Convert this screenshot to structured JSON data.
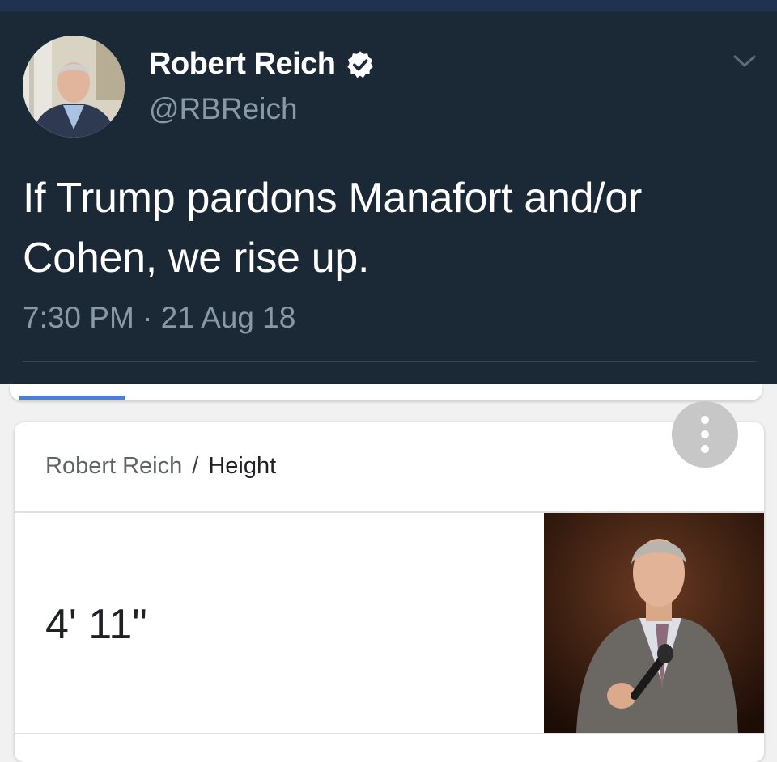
{
  "tweet": {
    "author_name": "Robert Reich",
    "handle": "@RBReich",
    "text": "If Trump pardons Manafort and/or Cohen, we rise up.",
    "timestamp": "7:30 PM · 21 Aug 18",
    "icons": {
      "verified": "verified-badge-icon",
      "menu": "chevron-down-icon"
    }
  },
  "knowledge_card": {
    "breadcrumb": {
      "entity": "Robert Reich",
      "separator": "/",
      "attribute": "Height"
    },
    "answer": "4' 11\"",
    "more_button_icon": "more-vert-icon"
  },
  "colors": {
    "tweet_background": "#1b2836",
    "card_background": "#ffffff",
    "accent": "#4a7fd4"
  }
}
